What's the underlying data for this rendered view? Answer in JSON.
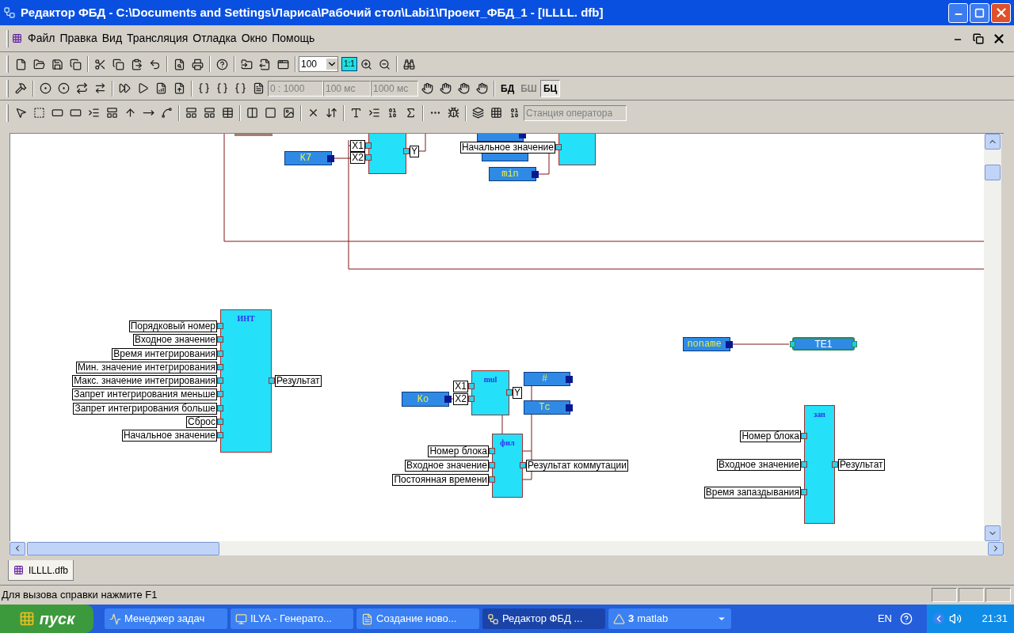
{
  "window": {
    "title": "Редактор ФБД - C:\\Documents and Settings\\Лариса\\Рабочий стол\\Labi1\\Проект_ФБД_1 - [ILLLL. dfb]"
  },
  "menu": [
    "Файл",
    "Правка",
    "Вид",
    "Трансляция",
    "Отладка",
    "Окно",
    "Помощь"
  ],
  "toolbars": {
    "zoom": "100",
    "actual_size": "1:1",
    "range": "0 : 1000",
    "step": "100 мс",
    "period": "1000 мс",
    "modes": [
      {
        "label": "БД",
        "selected": false,
        "disabled": false
      },
      {
        "label": "БШ",
        "selected": false,
        "disabled": true
      },
      {
        "label": "БЦ",
        "selected": true,
        "disabled": false
      }
    ],
    "station": {
      "value": "Станция оператора",
      "disabled": true
    }
  },
  "canvas": {
    "blocks": [
      {
        "kind": "constant",
        "name": "K7"
      },
      {
        "kind": "function",
        "inputs": [
          "X1",
          "X2"
        ],
        "outputs": [
          "Y"
        ]
      },
      {
        "kind": "constant"
      },
      {
        "kind": "function",
        "inputs": [
          "Начальное значение"
        ]
      },
      {
        "kind": "constant"
      },
      {
        "kind": "constant",
        "name": "min"
      },
      {
        "kind": "function",
        "title": "ИНТ",
        "inputs": [
          "Порядковый номер",
          "Входное значение",
          "Время интегрирования",
          "Мин. значение интегрирования",
          "Макс. значение интегрирования",
          "Запрет интегрирования меньше",
          "Запрет интегрирования больше",
          "Сброс",
          "Начальное значение"
        ],
        "outputs": [
          "Результат"
        ]
      },
      {
        "kind": "constant",
        "name": "Ko"
      },
      {
        "kind": "function",
        "title": "mul",
        "inputs": [
          "X1",
          "X2"
        ],
        "outputs": [
          "Y"
        ]
      },
      {
        "kind": "constant",
        "name": "#"
      },
      {
        "kind": "constant",
        "name": "Tc"
      },
      {
        "kind": "function",
        "title": "фил",
        "inputs": [
          "Номер блока",
          "Входное значение",
          "Постоянная времени"
        ],
        "outputs": [
          "Результат коммутации"
        ]
      },
      {
        "kind": "constant",
        "name": "noname"
      },
      {
        "kind": "terminal",
        "name": "TE1"
      },
      {
        "kind": "function",
        "title": "зап",
        "inputs": [
          "Номер блока",
          "Входное значение",
          "Время запаздывания"
        ],
        "outputs": [
          "Результат"
        ]
      }
    ]
  },
  "document_tabs": [
    {
      "label": "ILLLL.dfb",
      "selected": true
    }
  ],
  "status_bar": {
    "text": "Для вызова справки нажмите F1"
  },
  "taskbar": {
    "start": "пуск",
    "tasks": [
      {
        "label": "Менеджер задач",
        "selected": false
      },
      {
        "label": "ILYA - Генерато...",
        "selected": false
      },
      {
        "label": "Создание ново...",
        "selected": false
      },
      {
        "label": "Редактор ФБД ...",
        "selected": true
      },
      {
        "label": "matlab",
        "count": "3",
        "selected": false
      }
    ],
    "language": "EN",
    "clock": "21:31"
  }
}
